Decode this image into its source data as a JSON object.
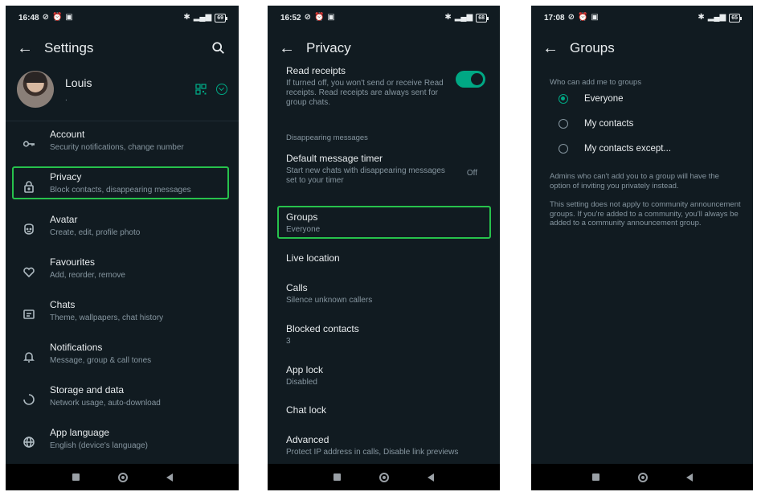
{
  "screen1": {
    "status": {
      "time": "16:48",
      "battery": "69",
      "signal": "4G"
    },
    "title": "Settings",
    "profile": {
      "name": "Louis",
      "about": "."
    },
    "items": [
      {
        "title": "Account",
        "sub": "Security notifications, change number",
        "icon": "key-icon"
      },
      {
        "title": "Privacy",
        "sub": "Block contacts, disappearing messages",
        "icon": "lock-icon"
      },
      {
        "title": "Avatar",
        "sub": "Create, edit, profile photo",
        "icon": "avatar-face-icon"
      },
      {
        "title": "Favourites",
        "sub": "Add, reorder, remove",
        "icon": "heart-icon"
      },
      {
        "title": "Chats",
        "sub": "Theme, wallpapers, chat history",
        "icon": "chat-icon"
      },
      {
        "title": "Notifications",
        "sub": "Message, group & call tones",
        "icon": "bell-icon"
      },
      {
        "title": "Storage and data",
        "sub": "Network usage, auto-download",
        "icon": "storage-circle-icon"
      },
      {
        "title": "App language",
        "sub": "English (device's language)",
        "icon": "globe-icon"
      }
    ]
  },
  "screen2": {
    "status": {
      "time": "16:52",
      "battery": "68",
      "signal": "4G"
    },
    "title": "Privacy",
    "read_receipts": {
      "title": "Read receipts",
      "sub": "If turned off, you won't send or receive Read receipts. Read receipts are always sent for group chats.",
      "enabled": true
    },
    "disappearing_section": "Disappearing messages",
    "default_timer": {
      "title": "Default message timer",
      "sub": "Start new chats with disappearing messages set to your timer",
      "value": "Off"
    },
    "items": [
      {
        "title": "Groups",
        "sub": "Everyone"
      },
      {
        "title": "Live location",
        "sub": ""
      },
      {
        "title": "Calls",
        "sub": "Silence unknown callers"
      },
      {
        "title": "Blocked contacts",
        "sub": "3"
      },
      {
        "title": "App lock",
        "sub": "Disabled"
      },
      {
        "title": "Chat lock",
        "sub": ""
      },
      {
        "title": "Advanced",
        "sub": "Protect IP address in calls, Disable link previews"
      }
    ]
  },
  "screen3": {
    "status": {
      "time": "17:08",
      "battery": "65",
      "signal": "4G"
    },
    "title": "Groups",
    "section": "Who can add me to groups",
    "options": [
      {
        "label": "Everyone",
        "selected": true
      },
      {
        "label": "My contacts",
        "selected": false
      },
      {
        "label": "My contacts except...",
        "selected": false
      }
    ],
    "note1": "Admins who can't add you to a group will have the option of inviting you privately instead.",
    "note2": "This setting does not apply to community announcement groups. If you're added to a community, you'll always be added to a community announcement group."
  },
  "colors": {
    "background": "#111b21",
    "accent": "#00a884",
    "highlight": "#27c24c",
    "secondary_text": "#8696a0"
  }
}
